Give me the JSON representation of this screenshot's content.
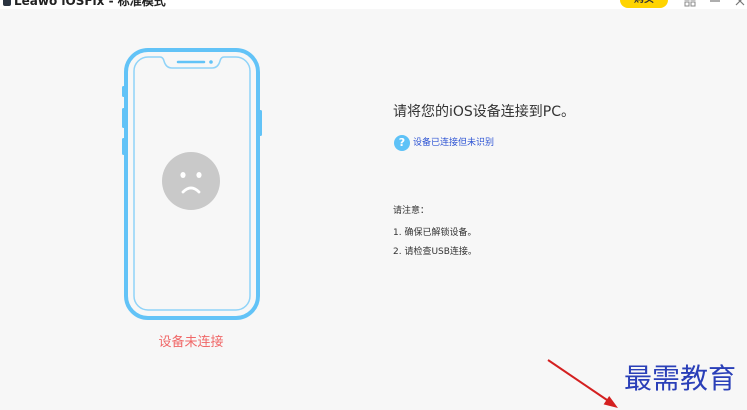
{
  "window": {
    "title": "Leawo iOSFix - 标准模式",
    "buy_label": "购买"
  },
  "device": {
    "status": "设备未连接"
  },
  "instructions": {
    "heading": "请将您的iOS设备连接到PC。",
    "help_link": "设备已连接但未识别",
    "help_icon_glyph": "?",
    "note_title": "请注意：",
    "steps": [
      "1. 确保已解锁设备。",
      "2. 请检查USB连接。"
    ]
  },
  "watermark": {
    "text": "最需教育"
  },
  "icons": [
    "app-icon",
    "menu-icon",
    "minimize-icon",
    "close-icon",
    "sad-face-icon",
    "question-icon",
    "red-arrow-icon"
  ],
  "colors": {
    "accent": "#5ec2f7",
    "buy_button": "#ffd400",
    "status_error": "#f06868",
    "link": "#2f55d4",
    "watermark": "#2a3fb8",
    "arrow": "#d42020"
  }
}
